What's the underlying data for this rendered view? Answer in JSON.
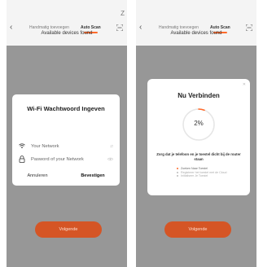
{
  "colors": {
    "accent": "#ff6a2a",
    "button": "#d55525",
    "overlay": "rgba(0,0,0,0.38)"
  },
  "screens": [
    {
      "top_nav": {
        "back_icon": "chevron-left-icon",
        "tab_manual": "Handmatig toevoegen",
        "tab_auto": "Auto Scan",
        "scan_icon": "scan-frame-icon",
        "corner_mark": "Z"
      },
      "available_devices": "Available devices found",
      "wifi_dialog": {
        "title": "Wi-Fi Wachtwoord Ingeven",
        "network_icon": "wifi-icon",
        "network_placeholder": "Your Network",
        "network_trail": "⇄",
        "password_icon": "lock-icon",
        "password_placeholder": "Pasword of your Network",
        "password_trail_icon": "eye-icon",
        "cancel": "Annuleren",
        "confirm": "Bevestigen"
      },
      "next_button": "Volgende"
    },
    {
      "top_nav": {
        "back_icon": "chevron-left-icon",
        "tab_manual": "Handmatig toevoegen",
        "tab_auto": "Auto Scan",
        "scan_icon": "scan-frame-icon"
      },
      "available_devices": "Available devices found",
      "connect_dialog": {
        "close_icon": "close-icon",
        "title": "Nu Verbinden",
        "progress_percent": 2,
        "progress_label": "2%",
        "note": "Zorg dat je telefoon en je toestel dicht bij de router staan",
        "steps": [
          {
            "label": "Zoeken Naar Toestel",
            "done": true
          },
          {
            "label": "Registreer het toestel met de Cloud",
            "done": false
          },
          {
            "label": "Initialiseer Je Toestel",
            "done": false
          }
        ]
      },
      "next_button": "Volgende"
    }
  ]
}
